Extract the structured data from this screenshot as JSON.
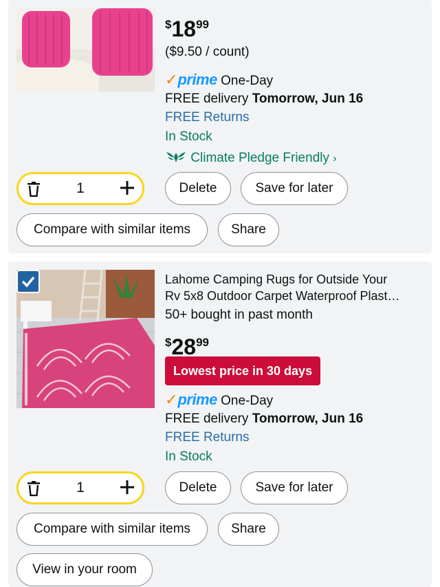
{
  "items": [
    {
      "price": {
        "currency": "$",
        "dollars": "18",
        "cents": "99"
      },
      "unit_price": "($9.50 / count)",
      "prime": {
        "brand": "prime",
        "service": "One-Day"
      },
      "delivery": {
        "prefix": "FREE delivery",
        "date": "Tomorrow, Jun 16"
      },
      "returns": "FREE Returns",
      "stock": "In Stock",
      "climate": "Climate Pledge Friendly",
      "quantity": "1",
      "buttons": {
        "delete": "Delete",
        "save": "Save for later",
        "compare": "Compare with similar items",
        "share": "Share"
      }
    },
    {
      "title_line1": "Lahome Camping Rugs for Outside Your",
      "title_line2": "Rv 5x8 Outdoor Carpet Waterproof Plast…",
      "bought": "50+ bought in past month",
      "price": {
        "currency": "$",
        "dollars": "28",
        "cents": "99"
      },
      "badge": "Lowest price in 30 days",
      "prime": {
        "brand": "prime",
        "service": "One-Day"
      },
      "delivery": {
        "prefix": "FREE delivery",
        "date": "Tomorrow, Jun 16"
      },
      "returns": "FREE Returns",
      "stock": "In Stock",
      "quantity": "1",
      "buttons": {
        "delete": "Delete",
        "save": "Save for later",
        "compare": "Compare with similar items",
        "share": "Share",
        "view_room": "View in your room"
      }
    }
  ],
  "colors": {
    "prime_check": "#f08804",
    "prime_word": "#1a98ff",
    "badge": "#cc0c39",
    "qty_border": "#f8d61c",
    "teal": "#2b6ea3",
    "green": "#067d62"
  }
}
